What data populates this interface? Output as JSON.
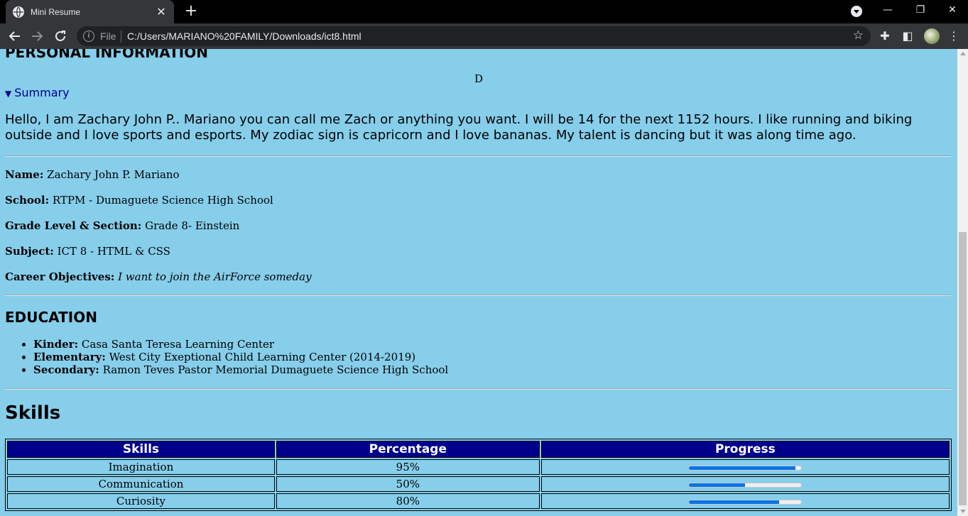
{
  "browser": {
    "tab_title": "Mini Resume",
    "tab_close": "✕",
    "new_tab": "+",
    "scheme": "File",
    "url": "C:/Users/MARIANO%20FAMILY/Downloads/ict8.html"
  },
  "page": {
    "personal_heading": "PERSONAL INFORMATION",
    "center_char": "D",
    "summary_label": "Summary",
    "summary_text": "Hello, I am Zachary John P.. Mariano you can call me Zach or anything you want. I will be 14 for the next 1152 hours. I like running and biking outside and I love sports and esports. My zodiac sign is capricorn and I love bananas. My talent is dancing but it was along time ago.",
    "info": [
      {
        "label": "Name:",
        "value": "Zachary John P. Mariano"
      },
      {
        "label": "School:",
        "value": "RTPM - Dumaguete Science High School"
      },
      {
        "label": "Grade Level & Section:",
        "value": "Grade 8- Einstein"
      },
      {
        "label": "Subject:",
        "value": "ICT 8 - HTML & CSS"
      },
      {
        "label": "Career Objectives:",
        "value": "I want to join the AirForce someday"
      }
    ],
    "education_heading": "EDUCATION",
    "education": [
      {
        "label": "Kinder:",
        "value": "Casa Santa Teresa Learning Center"
      },
      {
        "label": "Elementary:",
        "value": "West City Exeptional Child Learning Center (2014-2019)"
      },
      {
        "label": "Secondary:",
        "value": "Ramon Teves Pastor Memorial Dumaguete Science High School"
      }
    ],
    "skills_heading": "Skills",
    "skills_table": {
      "headers": [
        "Skills",
        "Percentage",
        "Progress"
      ],
      "rows": [
        {
          "skill": "Imagination",
          "percent": "95%",
          "progress": 0.95
        },
        {
          "skill": "Communication",
          "percent": "50%",
          "progress": 0.5
        },
        {
          "skill": "Curiosity",
          "percent": "80%",
          "progress": 0.8
        }
      ]
    }
  },
  "colors": {
    "page_bg": "#87ceeb",
    "table_header_bg": "#00008b",
    "summary_link": "#00008b",
    "progress_fill": "#0a74e6"
  }
}
